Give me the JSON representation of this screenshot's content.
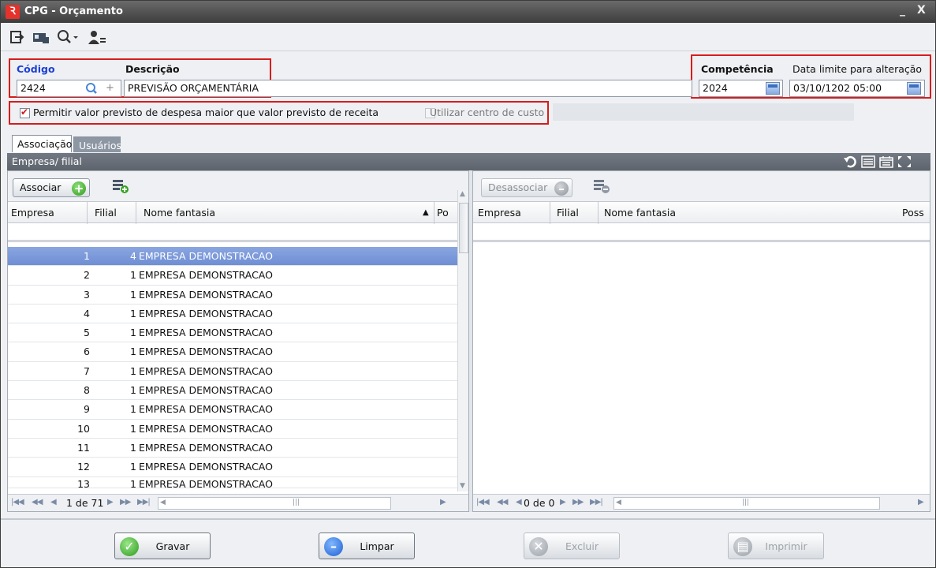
{
  "window": {
    "title": "CPG - Orçamento",
    "minimize": "_",
    "close": "X",
    "logo": "Ꝛ"
  },
  "form": {
    "codigo_label": "Código",
    "codigo_value": "2424",
    "descricao_label": "Descrição",
    "descricao_value": "PREVISÃO ORÇAMENTÁRIA",
    "competencia_label": "Competência",
    "competencia_value": "2024",
    "data_limite_label": "Data limite para alteração",
    "data_limite_value": "03/10/1202 05:00",
    "permitir_label": "Permitir valor  previsto de despesa maior que valor previsto de receita",
    "permitir_checked": true,
    "centro_custo_label": "Utilizar centro de custo",
    "centro_custo_checked": false
  },
  "tabs": [
    {
      "label": "Associação"
    },
    {
      "label": "Usuários"
    }
  ],
  "group": {
    "title": "Empresa/ filial"
  },
  "left": {
    "button": "Associar",
    "columns": {
      "empresa": "Empresa",
      "filial": "Filial",
      "nome": "Nome fantasia",
      "pos": "Po"
    },
    "rows": [
      {
        "empresa": "1",
        "filial": "4",
        "nome": "EMPRESA DEMONSTRACAO"
      },
      {
        "empresa": "2",
        "filial": "1",
        "nome": "EMPRESA DEMONSTRACAO"
      },
      {
        "empresa": "3",
        "filial": "1",
        "nome": "EMPRESA DEMONSTRACAO"
      },
      {
        "empresa": "4",
        "filial": "1",
        "nome": "EMPRESA DEMONSTRACAO"
      },
      {
        "empresa": "5",
        "filial": "1",
        "nome": "EMPRESA DEMONSTRACAO"
      },
      {
        "empresa": "6",
        "filial": "1",
        "nome": "EMPRESA DEMONSTRACAO"
      },
      {
        "empresa": "7",
        "filial": "1",
        "nome": "EMPRESA DEMONSTRACAO"
      },
      {
        "empresa": "8",
        "filial": "1",
        "nome": "EMPRESA DEMONSTRACAO"
      },
      {
        "empresa": "9",
        "filial": "1",
        "nome": "EMPRESA DEMONSTRACAO"
      },
      {
        "empresa": "10",
        "filial": "1",
        "nome": "EMPRESA DEMONSTRACAO"
      },
      {
        "empresa": "11",
        "filial": "1",
        "nome": "EMPRESA DEMONSTRACAO"
      },
      {
        "empresa": "12",
        "filial": "1",
        "nome": "EMPRESA DEMONSTRACAO"
      },
      {
        "empresa": "13",
        "filial": "1",
        "nome": "EMPRESA DEMONSTRACAO"
      }
    ],
    "pager": "1 de 71"
  },
  "right": {
    "button": "Desassociar",
    "columns": {
      "empresa": "Empresa",
      "filial": "Filial",
      "nome": "Nome fantasia",
      "pos": "Poss"
    },
    "pager": "0 de 0"
  },
  "footer": {
    "gravar": "Gravar",
    "limpar": "Limpar",
    "excluir": "Excluir",
    "imprimir": "Imprimir"
  }
}
